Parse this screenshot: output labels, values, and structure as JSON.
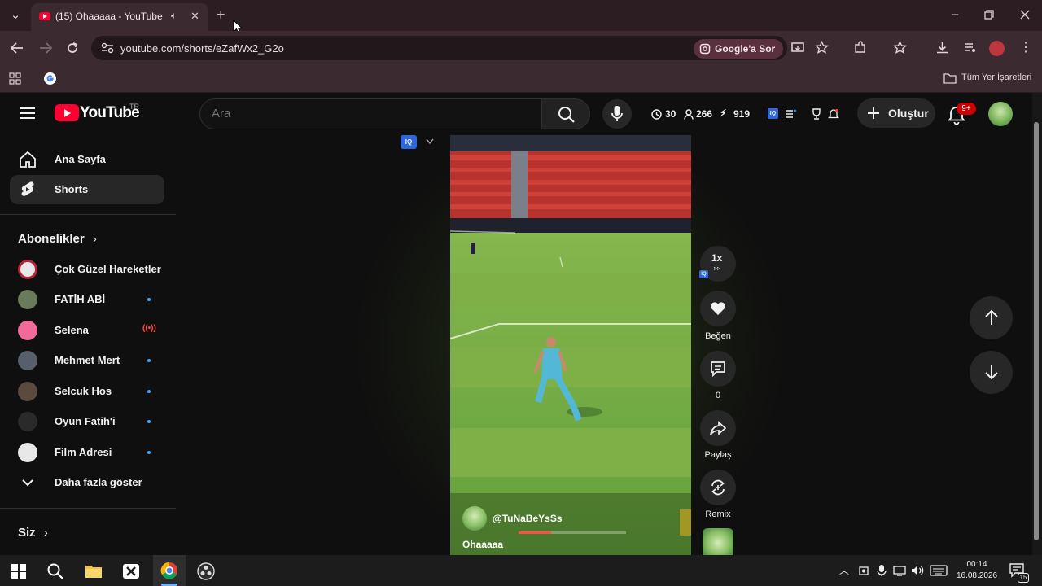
{
  "browser": {
    "tab_title": "(15) Ohaaaaa - YouTube",
    "url": "youtube.com/shorts/eZafWx2_G2o",
    "google_ask_label": "Google'a Sor",
    "all_bookmarks_label": "Tüm Yer İşaretleri",
    "new_tab_symbol": "+",
    "close_tab_symbol": "✕"
  },
  "masthead": {
    "logo_text": "YouTube",
    "logo_region": "TR",
    "search_placeholder": "Ara",
    "stats": {
      "history": "30",
      "subscribers": "266",
      "points": "919"
    },
    "create_label": "Oluştur",
    "notification_count": "9+"
  },
  "sidebar": {
    "main": [
      {
        "label": "Ana Sayfa",
        "icon": "home-icon",
        "active": false
      },
      {
        "label": "Shorts",
        "icon": "shorts-icon",
        "active": true
      }
    ],
    "subscriptions_title": "Abonelikler",
    "subscriptions": [
      {
        "label": "Çok Güzel Hareketler",
        "indicator": "none",
        "color": "#b3243c"
      },
      {
        "label": "FATİH ABİ",
        "indicator": "dot",
        "color": "#6a7a5a"
      },
      {
        "label": "Selena",
        "indicator": "live",
        "color": "#f06a9a"
      },
      {
        "label": "Mehmet Mert",
        "indicator": "dot",
        "color": "#57606a"
      },
      {
        "label": "Selcuk Hos",
        "indicator": "dot",
        "color": "#5a4a40"
      },
      {
        "label": "Oyun Fatih'i",
        "indicator": "dot",
        "color": "#2a2a2a"
      },
      {
        "label": "Film Adresi",
        "indicator": "dot",
        "color": "#e8e8e8"
      }
    ],
    "show_more_label": "Daha fazla göster",
    "you_title": "Siz"
  },
  "short": {
    "channel": "@TuNaBeYsSs",
    "title": "Ohaaaaa",
    "speed_label": "1x",
    "like_label": "Beğen",
    "comment_count": "0",
    "share_label": "Paylaş",
    "remix_label": "Remix",
    "iq_label": "IQ",
    "progress": 0.3
  },
  "taskbar": {
    "time": "00:14",
    "date": "16.08.2026",
    "notification_count": "15"
  },
  "colors": {
    "accent_red": "#ff0033",
    "sub_dot": "#3ea6ff",
    "live_red": "#ff4e45",
    "browser_frame": "#3b2a30"
  }
}
